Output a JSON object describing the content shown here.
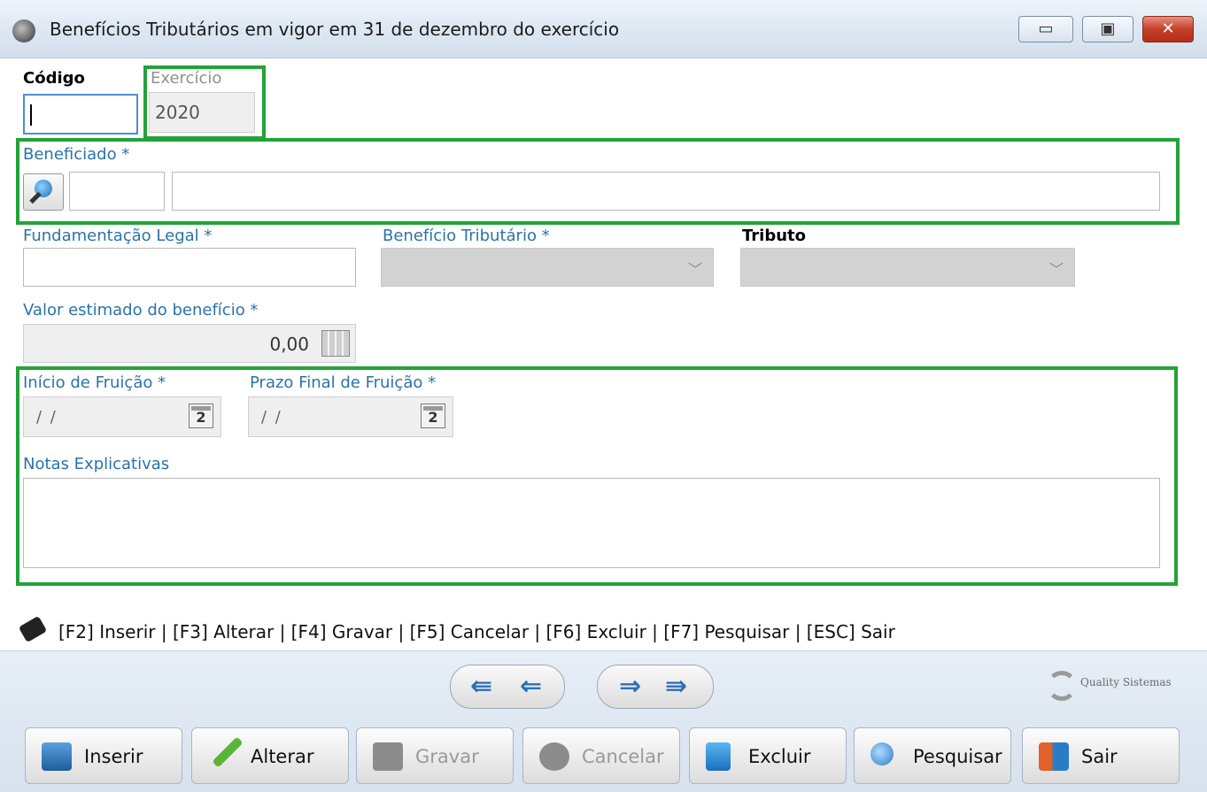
{
  "window": {
    "title": "Benefícios Tributários em vigor em 31 de dezembro do exercício",
    "controls": {
      "minimize": "▭",
      "maximize": "▣",
      "close": "✕"
    }
  },
  "form": {
    "codigo": {
      "label": "Código",
      "value": ""
    },
    "exercicio": {
      "label": "Exercício",
      "value": "2020"
    },
    "beneficiado": {
      "label": "Beneficiado *",
      "code_value": "",
      "name_value": ""
    },
    "fundamentacao": {
      "label": "Fundamentação Legal *",
      "value": ""
    },
    "beneficio_tributario": {
      "label": "Benefício Tributário *",
      "value": ""
    },
    "tributo": {
      "label": "Tributo",
      "value": ""
    },
    "valor_estimado": {
      "label": "Valor estimado do benefício *",
      "value": "0,00"
    },
    "inicio_fruicao": {
      "label": "Início de Fruição *",
      "value": "/ /"
    },
    "prazo_final": {
      "label": "Prazo Final de Fruição *",
      "value": "/ /"
    },
    "notas": {
      "label": "Notas Explicativas",
      "value": ""
    },
    "calendar_day": "2",
    "chevron": "﹀"
  },
  "shortcuts": "[F2] Inserir | [F3] Alterar | [F4] Gravar | [F5] Cancelar | [F6] Excluir | [F7] Pesquisar | [ESC] Sair",
  "nav": {
    "first": "⇚",
    "prev": "⇐",
    "next": "⇒",
    "last": "⇛"
  },
  "logo": "Quality Sistemas",
  "buttons": {
    "inserir": "Inserir",
    "alterar": "Alterar",
    "gravar": "Gravar",
    "cancelar": "Cancelar",
    "excluir": "Excluir",
    "pesquisar": "Pesquisar",
    "sair": "Sair"
  },
  "colors": {
    "highlight": "#22a339",
    "label_blue": "#2a73a8",
    "toolbar_bg": "#dfe8f2"
  }
}
